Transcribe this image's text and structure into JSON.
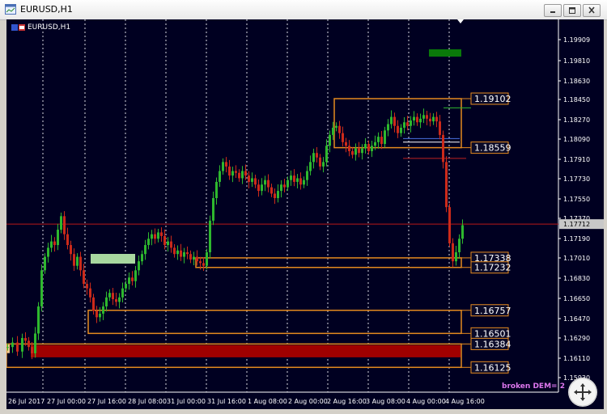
{
  "window": {
    "title": "EURUSD,H1",
    "buttons": [
      "minimize",
      "restore",
      "close"
    ]
  },
  "chart": {
    "symbol_label": "EURUSD,H1",
    "broken_text": "broken DEM= 2",
    "current_price": "1.17712",
    "price_axis": [
      "1.19909",
      "1.19810",
      "1.18630",
      "1.18450",
      "1.18270",
      "1.18090",
      "1.17910",
      "1.17730",
      "1.17550",
      "1.17370",
      "1.17190",
      "1.17010",
      "1.16830",
      "1.16650",
      "1.16470",
      "1.16290",
      "1.16110",
      "1.15930"
    ],
    "time_axis": [
      "26 Jul 2017",
      "27 Jul 00:00",
      "27 Jul 16:00",
      "28 Jul 08:00",
      "31 Jul 00:00",
      "31 Jul 16:00",
      "1 Aug 08:00",
      "2 Aug 00:00",
      "2 Aug 16:00",
      "3 Aug 08:00",
      "4 Aug 00:00",
      "4 Aug 16:00"
    ],
    "levels": [
      "1.19102",
      "1.18559",
      "1.17338",
      "1.17232",
      "1.16757",
      "1.16501",
      "1.16384",
      "1.16125"
    ]
  },
  "chart_data": {
    "type": "candlestick",
    "title": "EURUSD,H1",
    "ylim": [
      1.1585,
      1.1998
    ],
    "price_levels": [
      1.19102,
      1.18559,
      1.17338,
      1.17232,
      1.16757,
      1.16501,
      1.16384,
      1.16125
    ],
    "current_price": 1.17712,
    "colors": {
      "background": "#000021",
      "bull": "#2eb82e",
      "bear": "#cc2a1a",
      "zone": "#e48a1f",
      "demand_fill": "#a00000"
    }
  }
}
